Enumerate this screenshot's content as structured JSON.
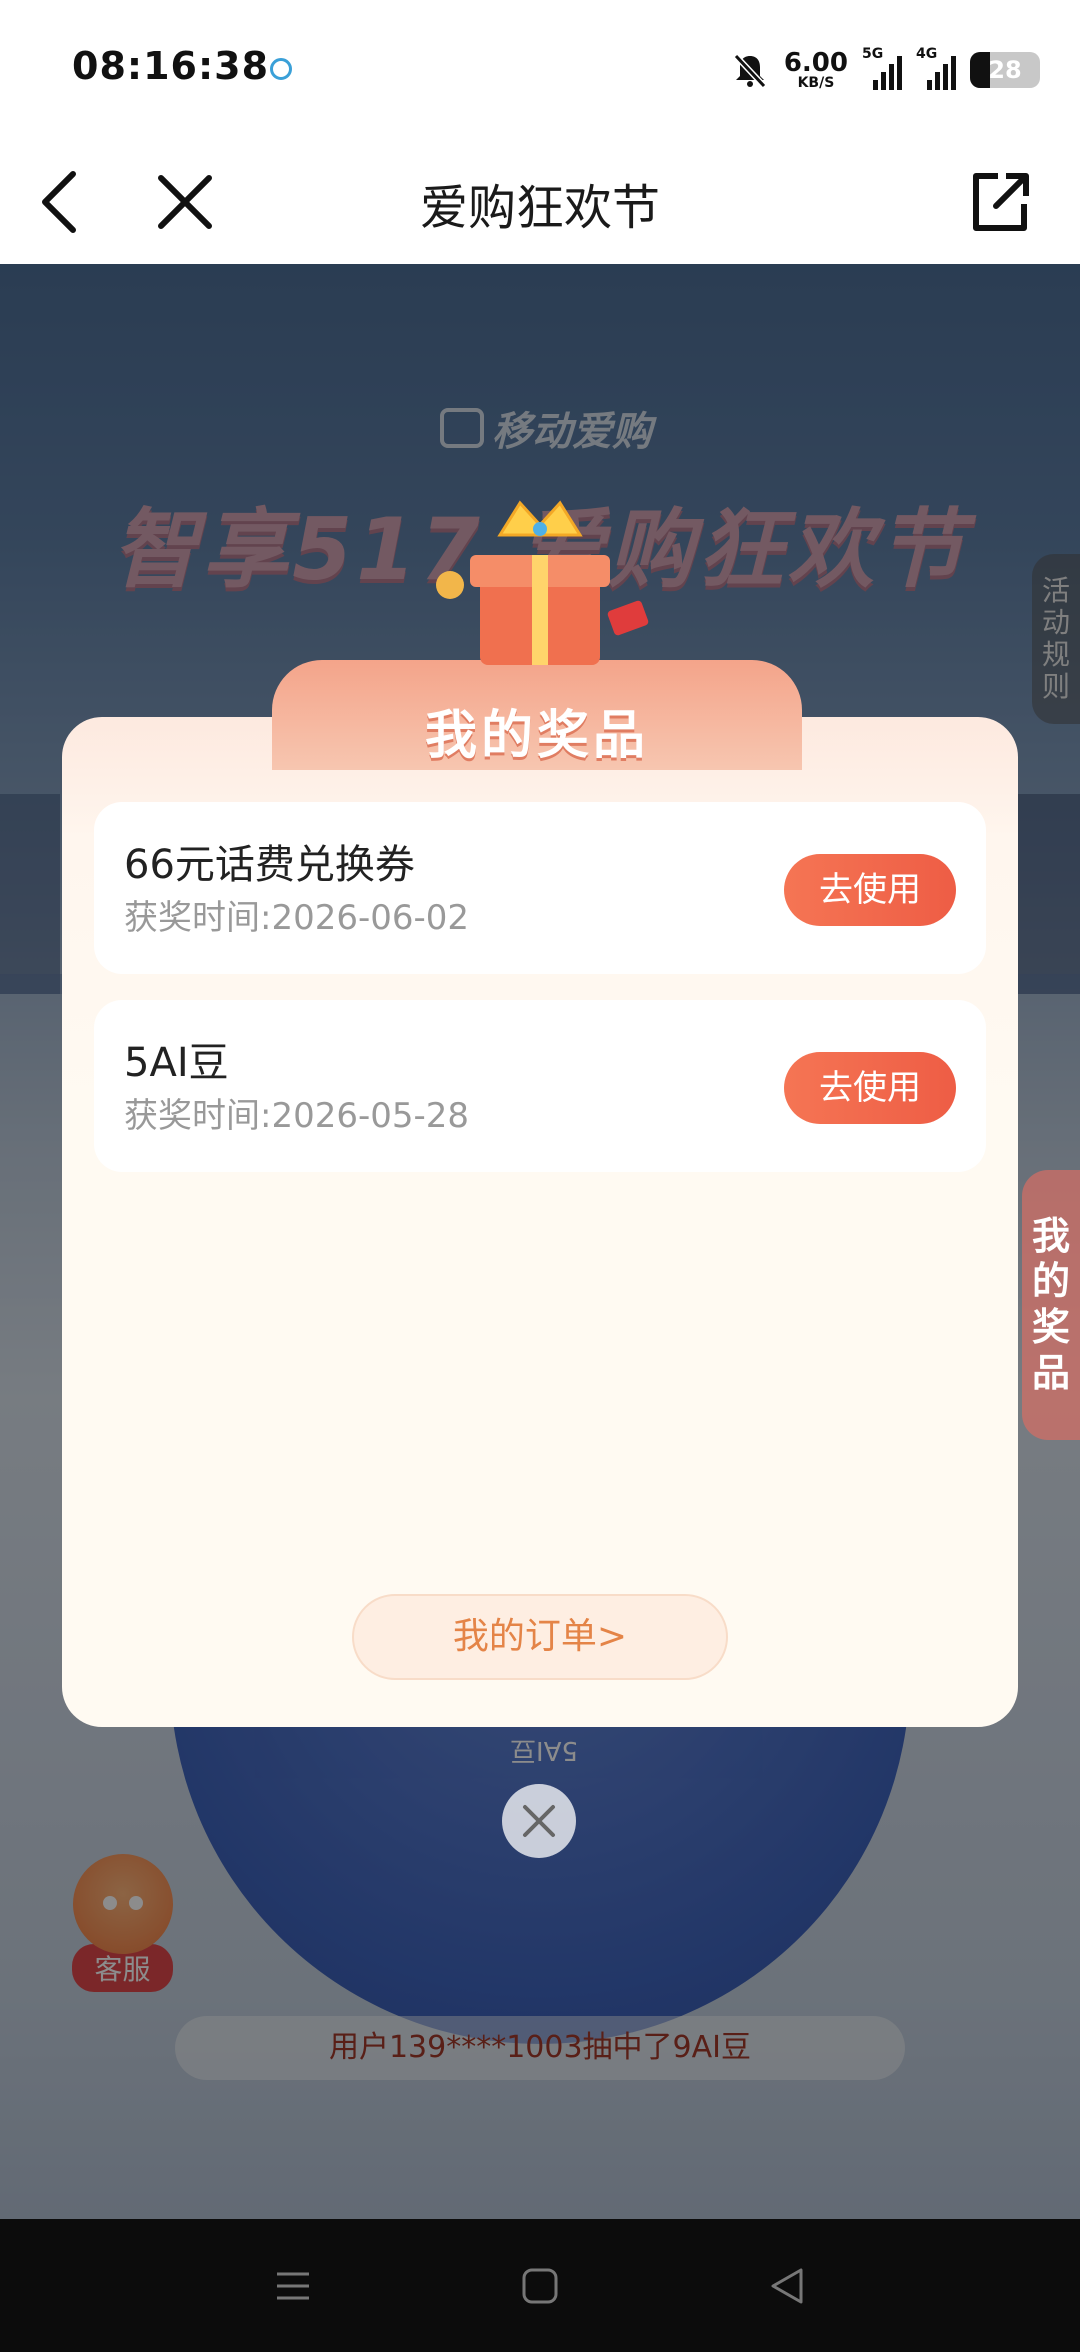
{
  "status_bar": {
    "time": "08:16:38",
    "net_speed_value": "6.00",
    "net_speed_unit": "KB/S",
    "signal1_label": "5G",
    "signal2_label": "4G",
    "battery": "28",
    "icons": [
      "carrier-icon",
      "mute-bell-icon",
      "signal-icon",
      "battery-icon"
    ]
  },
  "nav": {
    "title": "爱购狂欢节",
    "icons": [
      "back-icon",
      "close-icon",
      "share-icon"
    ]
  },
  "background": {
    "logo_text": "移动爱购",
    "banner_text": "智享517 爱购狂欢节",
    "rules_tab": [
      "活",
      "动",
      "规",
      "则"
    ],
    "prizes_tab": [
      "我",
      "的",
      "奖",
      "品"
    ],
    "wheel_label": "5AI豆",
    "service_label": "客服",
    "ticker": "用户139****1003抽中了9AI豆"
  },
  "modal": {
    "title": "我的奖品",
    "prizes": [
      {
        "name": "66元话费兑换券",
        "time": "获奖时间:2026-06-02",
        "button": "去使用"
      },
      {
        "name": "5AI豆",
        "time": "获奖时间:2026-05-28",
        "button": "去使用"
      }
    ],
    "order_button": "我的订单>"
  },
  "colors": {
    "accent": "#ee5d45",
    "order_text": "#e48447",
    "modal_bg": "#fffaf2"
  }
}
